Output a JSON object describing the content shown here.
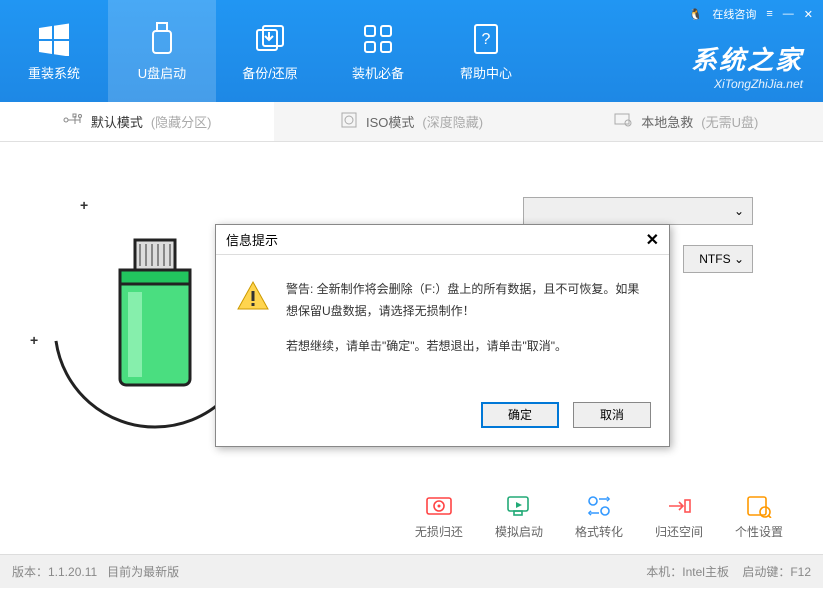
{
  "titlebar": {
    "consult": "在线咨询",
    "menu": "≡",
    "min": "—",
    "close": "✕"
  },
  "nav": [
    {
      "label": "重装系统"
    },
    {
      "label": "U盘启动"
    },
    {
      "label": "备份/还原"
    },
    {
      "label": "装机必备"
    },
    {
      "label": "帮助中心"
    }
  ],
  "brand": {
    "main": "系统之家",
    "sub": "XiTongZhiJia.net"
  },
  "subtabs": [
    {
      "label": "默认模式",
      "hint": "(隐藏分区)"
    },
    {
      "label": "ISO模式",
      "hint": "(深度隐藏)"
    },
    {
      "label": "本地急救",
      "hint": "(无需U盘)"
    }
  ],
  "dropdowns": {
    "fs": "NTFS"
  },
  "actions": [
    {
      "label": "无损归还"
    },
    {
      "label": "模拟启动"
    },
    {
      "label": "格式转化"
    },
    {
      "label": "归还空间"
    },
    {
      "label": "个性设置"
    }
  ],
  "footer": {
    "left_version": "版本：1.1.20.11",
    "left_status": "目前为最新版",
    "right_board": "本机：Intel主板",
    "right_key": "启动键：F12"
  },
  "modal": {
    "title": "信息提示",
    "line1": "警告: 全新制作将会删除（F:）盘上的所有数据，且不可恢复。如果想保留U盘数据，请选择无损制作！",
    "line2": "若想继续，请单击\"确定\"。若想退出，请单击\"取消\"。",
    "ok": "确定",
    "cancel": "取消"
  }
}
